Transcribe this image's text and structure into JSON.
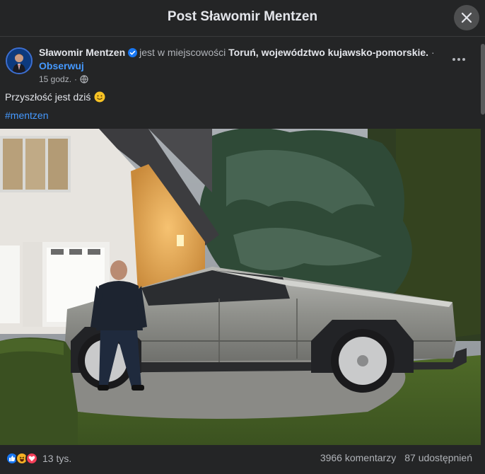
{
  "dialog": {
    "title": "Post Sławomir Mentzen"
  },
  "post": {
    "author": "Sławomir Mentzen",
    "location_prefix": "jest w miejscowości",
    "location": "Toruń, województwo kujawsko-pomorskie.",
    "location_suffix": "·",
    "follow_label": "Obserwuj",
    "time": "15 godz.",
    "time_separator": "·",
    "text": "Przyszłość jest dziś",
    "hashtag": "#mentzen"
  },
  "footer": {
    "reaction_count": "13 tys.",
    "comments": "3966 komentarzy",
    "shares": "87 udostępnień"
  },
  "colors": {
    "background": "#242526",
    "link": "#4599ff",
    "muted": "#b0b3b8",
    "like": "#1877f2",
    "love": "#f33e58",
    "haha": "#f7b125"
  },
  "icons": [
    "close-icon",
    "verified-badge-icon",
    "globe-icon",
    "more-options-icon",
    "smiley-emoji-icon",
    "like-reaction-icon",
    "haha-reaction-icon",
    "love-reaction-icon"
  ]
}
